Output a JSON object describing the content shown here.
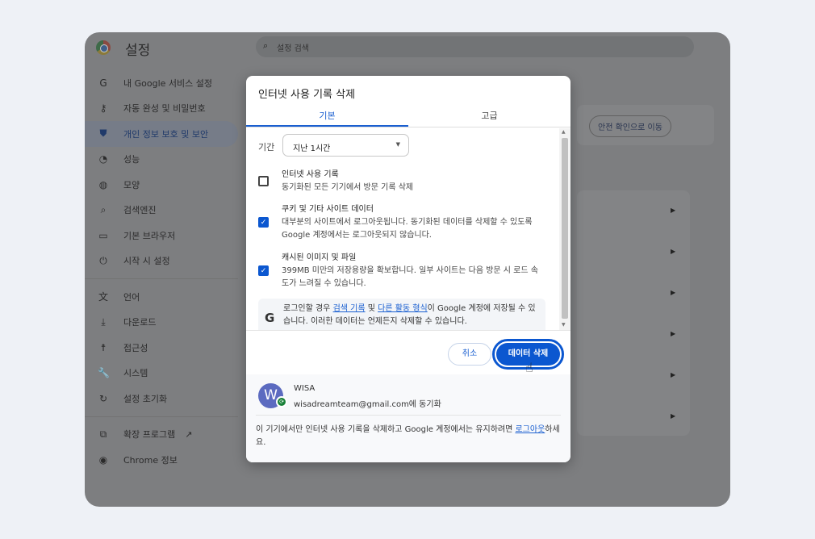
{
  "app": {
    "title": "설정",
    "search_placeholder": "설정 검색"
  },
  "sidebar": {
    "items": [
      {
        "label": "내 Google 서비스 설정",
        "icon": "google-icon"
      },
      {
        "label": "자동 완성 및 비밀번호",
        "icon": "key-icon"
      },
      {
        "label": "개인 정보 보호 및 보안",
        "icon": "shield-icon",
        "active": true
      },
      {
        "label": "성능",
        "icon": "gauge-icon"
      },
      {
        "label": "모양",
        "icon": "palette-icon"
      },
      {
        "label": "검색엔진",
        "icon": "search-icon"
      },
      {
        "label": "기본 브라우저",
        "icon": "browser-icon"
      },
      {
        "label": "시작 시 설정",
        "icon": "power-icon"
      },
      {
        "label": "언어",
        "icon": "translate-icon"
      },
      {
        "label": "다운로드",
        "icon": "download-icon"
      },
      {
        "label": "접근성",
        "icon": "accessibility-icon"
      },
      {
        "label": "시스템",
        "icon": "wrench-icon"
      },
      {
        "label": "설정 초기화",
        "icon": "reset-icon"
      },
      {
        "label": "확장 프로그램",
        "icon": "extension-icon"
      },
      {
        "label": "Chrome 정보",
        "icon": "chrome-icon"
      }
    ]
  },
  "main": {
    "safety_button": "안전 확인으로 이동"
  },
  "dialog": {
    "title": "인터넷 사용 기록 삭제",
    "tabs": [
      "기본",
      "고급"
    ],
    "period_label": "기간",
    "period_value": "지난 1시간",
    "options": [
      {
        "title": "인터넷 사용 기록",
        "desc": "동기화된 모든 기기에서 방문 기록 삭제",
        "checked": false
      },
      {
        "title": "쿠키 및 기타 사이트 데이터",
        "desc": "대부분의 사이트에서 로그아웃됩니다. 동기화된 데이터를 삭제할 수 있도록 Google 계정에서는 로그아웃되지 않습니다.",
        "checked": true
      },
      {
        "title": "캐시된 이미지 및 파일",
        "desc": "399MB 미만의 저장용량을 확보합니다. 일부 사이트는 다음 방문 시 로드 속도가 느려질 수 있습니다.",
        "checked": true
      }
    ],
    "google_note": {
      "pre": "로그인할 경우 ",
      "link1": "검색 기록",
      "mid": " 및 ",
      "link2": "다른 활동 형식",
      "post": "이 Google 계정에 저장될 수 있습니다. 이러한 데이터는 언제든지 삭제할 수 있습니다."
    },
    "cancel": "취소",
    "delete": "데이터 삭제",
    "account": {
      "initial": "W",
      "name": "WISA",
      "email": "wisadreamteam@gmail.com에 동기화"
    },
    "footer": {
      "pre": "이 기기에서만 인터넷 사용 기록을 삭제하고 Google 계정에서는 유지하려면 ",
      "link": "로그아웃",
      "post": "하세요."
    }
  },
  "colors": {
    "accent": "#0b57d0",
    "avatar": "#5c6bc0",
    "sync": "#188038"
  }
}
